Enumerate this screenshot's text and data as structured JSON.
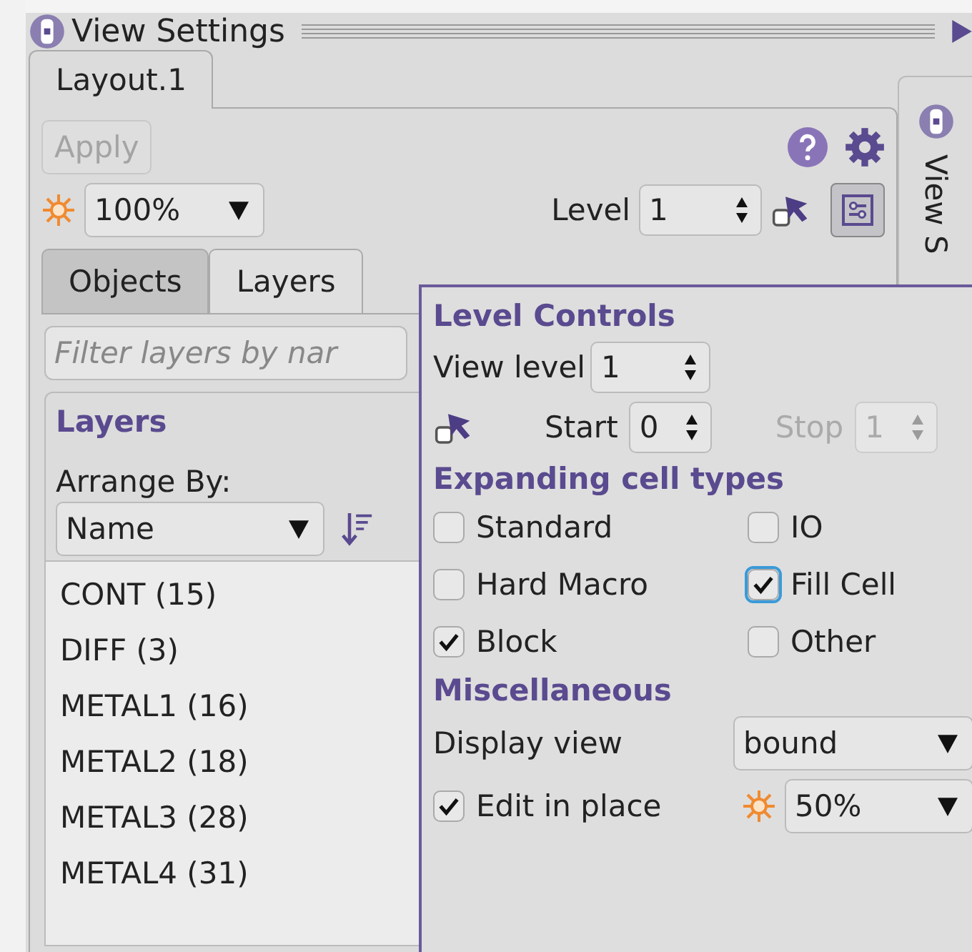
{
  "dock": {
    "title": "View Settings"
  },
  "side_dock": {
    "title": "View S"
  },
  "tabs": [
    {
      "label": "Layout.1",
      "selected": true
    }
  ],
  "apply_button": {
    "label": "Apply",
    "disabled": true
  },
  "zoom_combo": {
    "value": "100%"
  },
  "level": {
    "label": "Level",
    "value": "1"
  },
  "level_controls_toggle": {
    "on": true
  },
  "panel_tabs": [
    {
      "label": "Objects",
      "selected": false
    },
    {
      "label": "Layers",
      "selected": true
    }
  ],
  "filter": {
    "placeholder": "Filter layers by nar"
  },
  "layers_group": {
    "title": "Layers",
    "arrange_label": "Arrange By:",
    "arrange_value": "Name",
    "items": [
      {
        "label": "CONT (15)"
      },
      {
        "label": "DIFF (3)"
      },
      {
        "label": "METAL1 (16)"
      },
      {
        "label": "METAL2 (18)"
      },
      {
        "label": "METAL3 (28)"
      },
      {
        "label": "METAL4 (31)"
      }
    ]
  },
  "popup": {
    "title": "Level Controls",
    "view_level": {
      "label": "View level",
      "value": "1"
    },
    "start": {
      "label": "Start",
      "value": "0",
      "disabled": false
    },
    "stop": {
      "label": "Stop",
      "value": "1",
      "disabled": true
    },
    "cell_types_title": "Expanding cell types",
    "cell_types": [
      {
        "label": "Standard",
        "checked": false,
        "focused": false
      },
      {
        "label": "IO",
        "checked": false,
        "focused": false
      },
      {
        "label": "Hard Macro",
        "checked": false,
        "focused": false
      },
      {
        "label": "Fill Cell",
        "checked": true,
        "focused": true
      },
      {
        "label": "Block",
        "checked": true,
        "focused": false
      },
      {
        "label": "Other",
        "checked": false,
        "focused": false
      }
    ],
    "misc_title": "Miscellaneous",
    "display_view": {
      "label": "Display view",
      "value": "bound"
    },
    "edit_in_place": {
      "label": "Edit in place",
      "checked": true
    },
    "opacity": {
      "value": "50%"
    }
  }
}
